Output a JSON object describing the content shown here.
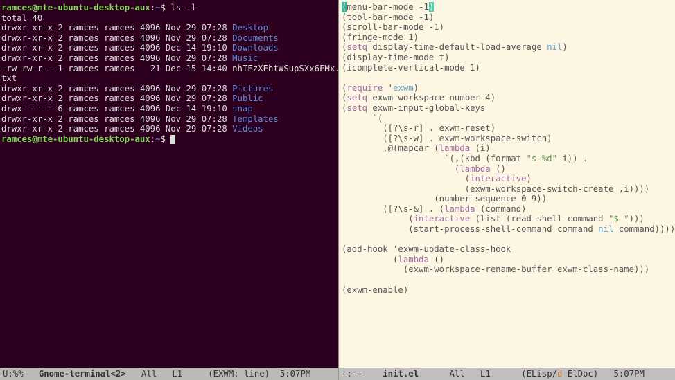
{
  "terminal": {
    "prompt_user": "ramces@mte-ubuntu-desktop-aux",
    "prompt_sep1": ":",
    "prompt_path": "~",
    "prompt_sep2": "$ ",
    "cmd1": "ls -l",
    "total_line": "total 40",
    "rows": [
      {
        "perm": "drwxr-xr-x",
        "n": "2",
        "o": "ramces",
        "g": "ramces",
        "sz": "4096",
        "date": "Nov 29 07:28",
        "name": "Desktop",
        "dir": true
      },
      {
        "perm": "drwxr-xr-x",
        "n": "2",
        "o": "ramces",
        "g": "ramces",
        "sz": "4096",
        "date": "Nov 29 07:28",
        "name": "Documents",
        "dir": true
      },
      {
        "perm": "drwxr-xr-x",
        "n": "2",
        "o": "ramces",
        "g": "ramces",
        "sz": "4096",
        "date": "Dec 14 19:10",
        "name": "Downloads",
        "dir": true
      },
      {
        "perm": "drwxr-xr-x",
        "n": "2",
        "o": "ramces",
        "g": "ramces",
        "sz": "4096",
        "date": "Nov 29 07:28",
        "name": "Music",
        "dir": true
      },
      {
        "perm": "-rw-rw-r--",
        "n": "1",
        "o": "ramces",
        "g": "ramces",
        "sz": "  21",
        "date": "Dec 15 14:40",
        "name": "nhTEzXEhtWSupSXx6FMx.",
        "dir": false,
        "wrap": "txt"
      },
      {
        "perm": "drwxr-xr-x",
        "n": "2",
        "o": "ramces",
        "g": "ramces",
        "sz": "4096",
        "date": "Nov 29 07:28",
        "name": "Pictures",
        "dir": true
      },
      {
        "perm": "drwxr-xr-x",
        "n": "2",
        "o": "ramces",
        "g": "ramces",
        "sz": "4096",
        "date": "Nov 29 07:28",
        "name": "Public",
        "dir": true
      },
      {
        "perm": "drwx------",
        "n": "6",
        "o": "ramces",
        "g": "ramces",
        "sz": "4096",
        "date": "Dec 14 19:10",
        "name": "snap",
        "dir": true
      },
      {
        "perm": "drwxr-xr-x",
        "n": "2",
        "o": "ramces",
        "g": "ramces",
        "sz": "4096",
        "date": "Nov 29 07:28",
        "name": "Templates",
        "dir": true
      },
      {
        "perm": "drwxr-xr-x",
        "n": "2",
        "o": "ramces",
        "g": "ramces",
        "sz": "4096",
        "date": "Nov 29 07:28",
        "name": "Videos",
        "dir": true
      }
    ]
  },
  "editor": {
    "lines": [
      [
        {
          "t": "(",
          "c": "cursor-r"
        },
        {
          "t": "menu-bar-mode -1",
          "c": ""
        },
        {
          "t": ")",
          "c": "paren-hl"
        }
      ],
      [
        {
          "t": "(tool-bar-mode -1)",
          "c": ""
        }
      ],
      [
        {
          "t": "(scroll-bar-mode -1)",
          "c": ""
        }
      ],
      [
        {
          "t": "(fringe-mode 1)",
          "c": ""
        }
      ],
      [
        {
          "t": "(",
          "c": ""
        },
        {
          "t": "setq",
          "c": "kw"
        },
        {
          "t": " display-time-default-load-average ",
          "c": ""
        },
        {
          "t": "nil",
          "c": "const"
        },
        {
          "t": ")",
          "c": ""
        }
      ],
      [
        {
          "t": "(display-time-mode t)",
          "c": ""
        }
      ],
      [
        {
          "t": "(icomplete-vertical-mode 1)",
          "c": ""
        }
      ],
      [
        {
          "t": "",
          "c": ""
        }
      ],
      [
        {
          "t": "(",
          "c": ""
        },
        {
          "t": "require",
          "c": "kw"
        },
        {
          "t": " '",
          "c": ""
        },
        {
          "t": "exwm",
          "c": "builtin"
        },
        {
          "t": ")",
          "c": ""
        }
      ],
      [
        {
          "t": "(",
          "c": ""
        },
        {
          "t": "setq",
          "c": "kw"
        },
        {
          "t": " exwm-workspace-number 4)",
          "c": ""
        }
      ],
      [
        {
          "t": "(",
          "c": ""
        },
        {
          "t": "setq",
          "c": "kw"
        },
        {
          "t": " exwm-input-global-keys",
          "c": ""
        }
      ],
      [
        {
          "t": "      `(",
          "c": ""
        }
      ],
      [
        {
          "t": "        ([?\\s-r] . exwm-reset)",
          "c": ""
        }
      ],
      [
        {
          "t": "        ([?\\s-w] . exwm-workspace-switch)",
          "c": ""
        }
      ],
      [
        {
          "t": "        ,@(mapcar (",
          "c": ""
        },
        {
          "t": "lambda",
          "c": "kw"
        },
        {
          "t": " (i)",
          "c": ""
        }
      ],
      [
        {
          "t": "                    `(,(kbd (format ",
          "c": ""
        },
        {
          "t": "\"s-%d\"",
          "c": "str"
        },
        {
          "t": " i)) .",
          "c": ""
        }
      ],
      [
        {
          "t": "                      (",
          "c": ""
        },
        {
          "t": "lambda",
          "c": "kw"
        },
        {
          "t": " ()",
          "c": ""
        }
      ],
      [
        {
          "t": "                        (",
          "c": ""
        },
        {
          "t": "interactive",
          "c": "kw"
        },
        {
          "t": ")",
          "c": ""
        }
      ],
      [
        {
          "t": "                        (exwm-workspace-switch-create ,i))))",
          "c": ""
        }
      ],
      [
        {
          "t": "                  (number-sequence 0 9))",
          "c": ""
        }
      ],
      [
        {
          "t": "        ([?\\s-&] . (",
          "c": ""
        },
        {
          "t": "lambda",
          "c": "kw"
        },
        {
          "t": " (command)",
          "c": ""
        }
      ],
      [
        {
          "t": "             (",
          "c": ""
        },
        {
          "t": "interactive",
          "c": "kw"
        },
        {
          "t": " (list (read-shell-command ",
          "c": ""
        },
        {
          "t": "\"$ \"",
          "c": "str"
        },
        {
          "t": ")))",
          "c": ""
        }
      ],
      [
        {
          "t": "             (start-process-shell-command command ",
          "c": ""
        },
        {
          "t": "nil",
          "c": "const"
        },
        {
          "t": " command)))))",
          "c": ""
        }
      ],
      [
        {
          "t": "",
          "c": ""
        }
      ],
      [
        {
          "t": "(add-hook 'exwm-update-class-hook",
          "c": ""
        }
      ],
      [
        {
          "t": "          (",
          "c": ""
        },
        {
          "t": "lambda",
          "c": "kw"
        },
        {
          "t": " ()",
          "c": ""
        }
      ],
      [
        {
          "t": "            (exwm-workspace-rename-buffer exwm-class-name)))",
          "c": ""
        }
      ],
      [
        {
          "t": "",
          "c": ""
        }
      ],
      [
        {
          "t": "(exwm-enable)",
          "c": ""
        }
      ]
    ]
  },
  "modeline_left": {
    "status": "U:%%-",
    "buffer": "Gnome-terminal<2>",
    "pos": "All",
    "line": "L1",
    "mode": "(EXWM: line)",
    "time": "5:07PM"
  },
  "modeline_right": {
    "status": "-:---",
    "buffer": "init.el",
    "pos": "All",
    "line": "L1",
    "mode1": "(ELisp",
    "mode_sep": "/",
    "mode_flag": "d",
    "mode2": " ElDoc)",
    "time": "5:07PM"
  }
}
